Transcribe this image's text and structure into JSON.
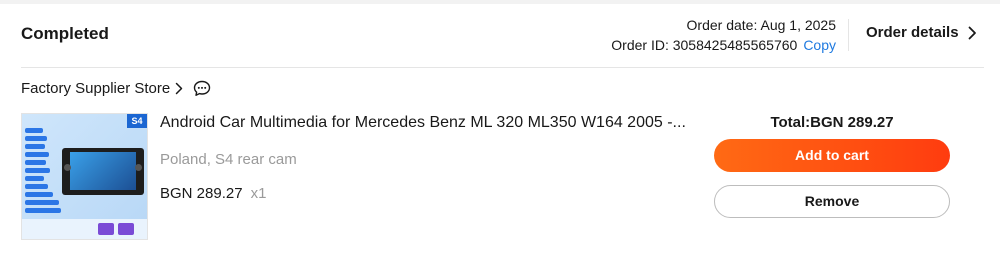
{
  "order": {
    "status": "Completed",
    "date_text": "Order date: Aug 1, 2025",
    "id_text": "Order ID: 3058425485565760",
    "copy_label": "Copy",
    "details_label": "Order details"
  },
  "store": {
    "name": "Factory Supplier Store"
  },
  "item": {
    "thumbnail_badge": "S4",
    "title": "Android Car Multimedia for Mercedes Benz ML 320 ML350 W164 2005 -...",
    "variant": "Poland, S4 rear cam",
    "price": "BGN 289.27",
    "quantity": "x1"
  },
  "summary": {
    "total": "Total:BGN 289.27"
  },
  "actions": {
    "add_to_cart": "Add to cart",
    "remove": "Remove"
  },
  "colors": {
    "accent_orange": "#ff4d12",
    "link_blue": "#1f7ae0",
    "muted_text": "#9a9a9a"
  },
  "icons": [
    "chevron-right-icon",
    "chat-bubble-icon"
  ]
}
